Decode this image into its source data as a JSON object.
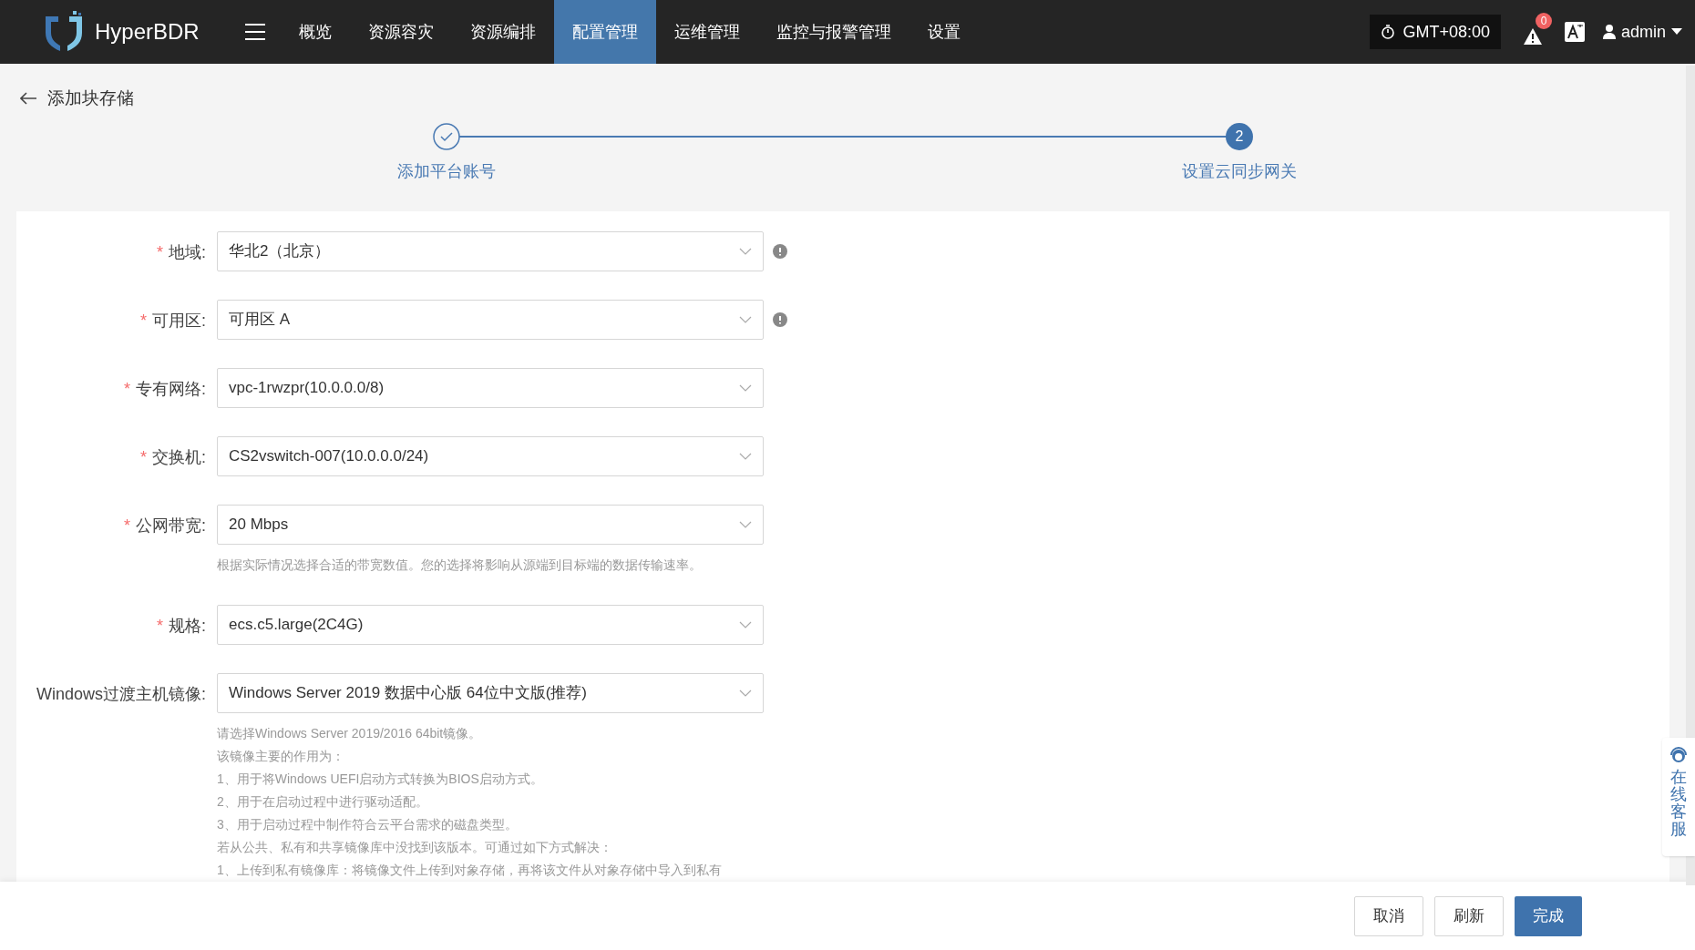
{
  "topbar": {
    "brand": "HyperBDR",
    "menu": [
      {
        "label": "概览",
        "selected": false
      },
      {
        "label": "资源容灾",
        "selected": false
      },
      {
        "label": "资源编排",
        "selected": false
      },
      {
        "label": "配置管理",
        "selected": true
      },
      {
        "label": "运维管理",
        "selected": false
      },
      {
        "label": "监控与报警管理",
        "selected": false
      },
      {
        "label": "设置",
        "selected": false
      }
    ],
    "timezone": "GMT+08:00",
    "alert_count": "0",
    "user": "admin"
  },
  "page_title": "添加块存储",
  "steps": [
    {
      "label": "添加平台账号",
      "completed": true
    },
    {
      "label": "设置云同步网关",
      "completed": false,
      "number": "2"
    }
  ],
  "form": [
    {
      "required_mark": "*",
      "label": "地域:",
      "value": "华北2（北京）",
      "info": true
    },
    {
      "required_mark": "*",
      "label": "可用区:",
      "value": "可用区 A",
      "info": true
    },
    {
      "required_mark": "*",
      "label": "专有网络:",
      "value": "vpc-1rwzpr(10.0.0.0/8)",
      "info": false
    },
    {
      "required_mark": "*",
      "label": "交换机:",
      "value": "CS2vswitch-007(10.0.0.0/24)",
      "info": false
    },
    {
      "required_mark": "*",
      "label": "公网带宽:",
      "value": "20 Mbps",
      "info": false,
      "hint": [
        "根据实际情况选择合适的带宽数值。您的选择将影响从源端到目标端的数据传输速率。"
      ]
    },
    {
      "required_mark": "*",
      "label": "规格:",
      "value": "ecs.c5.large(2C4G)",
      "info": false
    },
    {
      "label": "Windows过渡主机镜像:",
      "value": "Windows Server  2019 数据中心版 64位中文版(推荐)",
      "info": false,
      "hint": [
        "请选择Windows Server 2019/2016 64bit镜像。",
        "该镜像主要的作用为：",
        "1、用于将Windows UEFI启动方式转换为BIOS启动方式。",
        "2、用于在启动过程中进行驱动适配。",
        "3、用于启动过程中制作符合云平台需求的磁盘类型。",
        "若从公共、私有和共享镜像库中没找到该版本。可通过如下方式解决：",
        "1、上传到私有镜像库：将镜像文件上传到对象存储，再将该文件从对象存储中导入到私有"
      ]
    }
  ],
  "buttons": [
    {
      "label": "取消",
      "kind": "default"
    },
    {
      "label": "刷新",
      "kind": "default"
    },
    {
      "label": "完成",
      "kind": "primary"
    }
  ],
  "support": "在线客服"
}
